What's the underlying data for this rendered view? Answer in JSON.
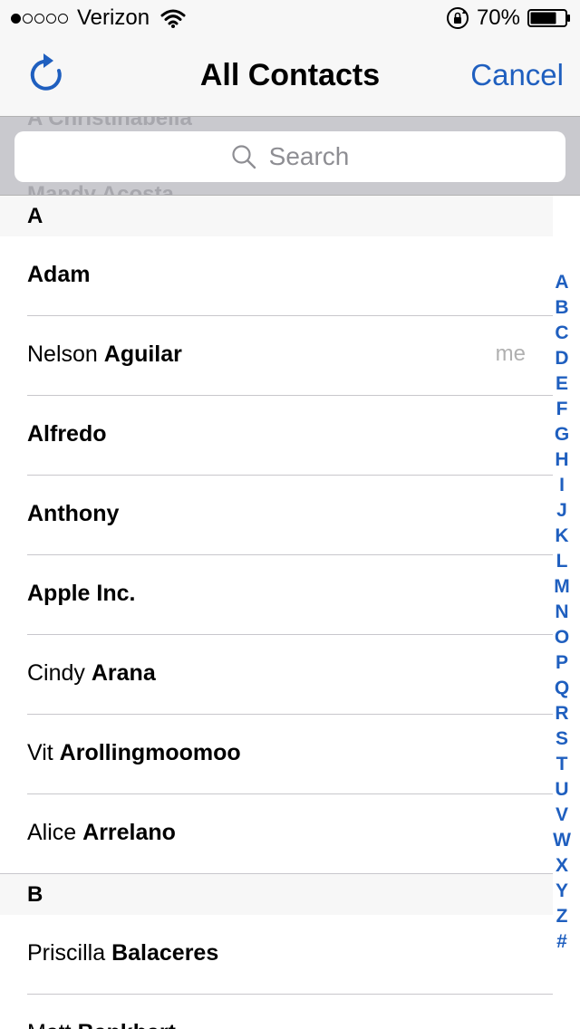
{
  "status_bar": {
    "carrier": "Verizon",
    "battery": "70%",
    "signal_dots_filled": 1,
    "signal_dots_total": 5
  },
  "nav": {
    "title": "All Contacts",
    "cancel_label": "Cancel"
  },
  "search": {
    "placeholder": "Search",
    "ghost_line_1": "A Christinabella",
    "ghost_line_2": "Mandy Acosta"
  },
  "sections": [
    {
      "letter": "A",
      "contacts": [
        {
          "first": "",
          "last": "Adam",
          "tag": ""
        },
        {
          "first": "Nelson",
          "last": "Aguilar",
          "tag": "me"
        },
        {
          "first": "",
          "last": "Alfredo",
          "tag": ""
        },
        {
          "first": "",
          "last": "Anthony",
          "tag": ""
        },
        {
          "first": "",
          "last": "Apple Inc.",
          "tag": ""
        },
        {
          "first": "Cindy",
          "last": "Arana",
          "tag": ""
        },
        {
          "first": "Vit",
          "last": "Arollingmoomoo",
          "tag": ""
        },
        {
          "first": "Alice",
          "last": "Arrelano",
          "tag": ""
        }
      ]
    },
    {
      "letter": "B",
      "contacts": [
        {
          "first": "Priscilla",
          "last": "Balaceres",
          "tag": ""
        },
        {
          "first": "Matt",
          "last": "Bankhart",
          "tag": ""
        }
      ]
    }
  ],
  "index_letters": [
    "A",
    "B",
    "C",
    "D",
    "E",
    "F",
    "G",
    "H",
    "I",
    "J",
    "K",
    "L",
    "M",
    "N",
    "O",
    "P",
    "Q",
    "R",
    "S",
    "T",
    "U",
    "V",
    "W",
    "X",
    "Y",
    "Z",
    "#"
  ],
  "colors": {
    "accent": "#1f5fbf",
    "bar_bg": "#f7f7f7",
    "search_bg": "#c9c9ce"
  }
}
